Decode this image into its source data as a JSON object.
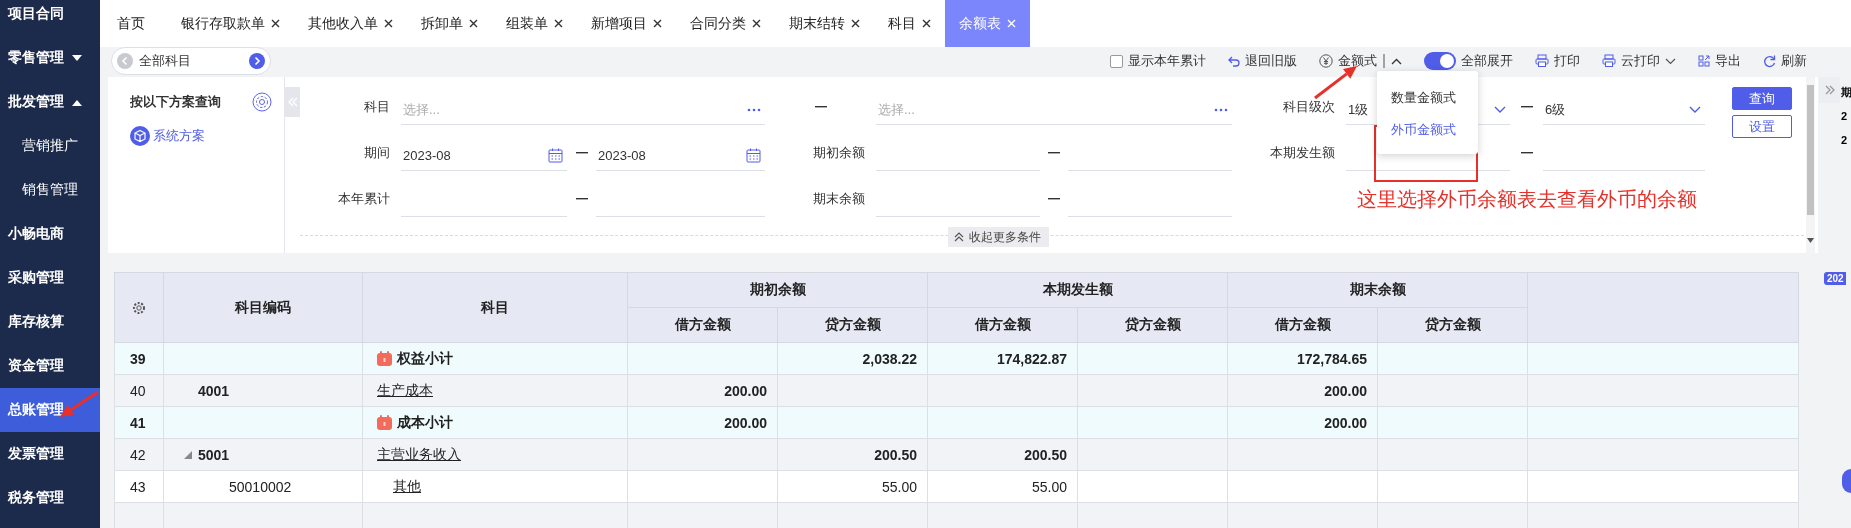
{
  "sidebar": {
    "items": [
      {
        "label": "项目合同",
        "selected": false
      },
      {
        "label": "零售管理",
        "selected": false,
        "expanded": false
      },
      {
        "label": "批发管理",
        "selected": false,
        "expanded": true,
        "children": [
          {
            "label": "营销推广",
            "selected": false
          },
          {
            "label": "销售管理",
            "selected": false
          }
        ]
      },
      {
        "label": "小畅电商",
        "selected": false
      },
      {
        "label": "采购管理",
        "selected": false
      },
      {
        "label": "库存核算",
        "selected": false
      },
      {
        "label": "资金管理",
        "selected": false
      },
      {
        "label": "总账管理",
        "selected": true
      },
      {
        "label": "发票管理",
        "selected": false
      },
      {
        "label": "税务管理",
        "selected": false
      }
    ]
  },
  "tabs": [
    {
      "label": "首页",
      "closable": false,
      "selected": false
    },
    {
      "label": "银行存取款单",
      "closable": true,
      "selected": false
    },
    {
      "label": "其他收入单",
      "closable": true,
      "selected": false
    },
    {
      "label": "拆卸单",
      "closable": true,
      "selected": false
    },
    {
      "label": "组装单",
      "closable": true,
      "selected": false
    },
    {
      "label": "新增项目",
      "closable": true,
      "selected": false
    },
    {
      "label": "合同分类",
      "closable": true,
      "selected": false
    },
    {
      "label": "期末结转",
      "closable": true,
      "selected": false
    },
    {
      "label": "科目",
      "closable": true,
      "selected": false
    },
    {
      "label": "余额表",
      "closable": true,
      "selected": true
    }
  ],
  "toolbar": {
    "subject_nav": "全部科目",
    "show_year_total": {
      "label": "显示本年累计",
      "checked": false
    },
    "revert": "退回旧版",
    "format": {
      "label": "金额式",
      "expanded": true
    },
    "expand_all": {
      "label": "全部展开",
      "on": true
    },
    "print": "打印",
    "cloud_print": "云打印",
    "export": "导出",
    "refresh": "刷新"
  },
  "format_menu": {
    "items": [
      {
        "label": "数量金额式",
        "selected": false
      },
      {
        "label": "外币金额式",
        "selected": true
      }
    ]
  },
  "scheme_panel": {
    "title": "按以下方案查询",
    "scheme": "系统方案"
  },
  "filters": {
    "subject": {
      "label": "科目",
      "from_placeholder": "选择...",
      "to_placeholder": "选择..."
    },
    "level": {
      "label": "科目级次",
      "from": "1级",
      "to": "6级"
    },
    "period": {
      "label": "期间",
      "from": "2023-08",
      "to": "2023-08"
    },
    "opening": {
      "label": "期初余额"
    },
    "current": {
      "label": "本期发生额"
    },
    "year_total": {
      "label": "本年累计"
    },
    "closing": {
      "label": "期末余额"
    },
    "query": "查询",
    "settings": "设置",
    "collapse": "收起更多条件"
  },
  "annotation": {
    "text": "这里选择外币余额表去查看外币的余额"
  },
  "table": {
    "columns": [
      {
        "label": "科目编码"
      },
      {
        "label": "科目"
      },
      {
        "label": "期初余额",
        "children": [
          "借方金额",
          "贷方金额"
        ]
      },
      {
        "label": "本期发生额",
        "children": [
          "借方金额",
          "贷方金额"
        ]
      },
      {
        "label": "期末余额",
        "children": [
          "借方金额",
          "贷方金额"
        ]
      }
    ],
    "rows": [
      {
        "index": "39",
        "kind": "subtotal",
        "name": "权益小计",
        "opening_credit": "2,038.22",
        "current_debit": "174,822.87",
        "closing_debit": "172,784.65"
      },
      {
        "index": "40",
        "kind": "account",
        "code": "4001",
        "name": "生产成本",
        "opening_debit": "200.00",
        "closing_debit": "200.00"
      },
      {
        "index": "41",
        "kind": "subtotal",
        "name": "成本小计",
        "opening_debit": "200.00",
        "closing_debit": "200.00"
      },
      {
        "index": "42",
        "kind": "account",
        "code": "5001",
        "name": "主营业务收入",
        "expanded": true,
        "opening_credit": "200.50",
        "current_debit": "200.50",
        "children": [
          {
            "index": "43",
            "kind": "account",
            "code": "50010002",
            "name": "其他",
            "opening_credit": "55.00",
            "current_debit": "55.00"
          }
        ]
      }
    ]
  },
  "right_panel": {
    "header": "期",
    "cells": [
      "2",
      "2"
    ],
    "badge": "202"
  }
}
